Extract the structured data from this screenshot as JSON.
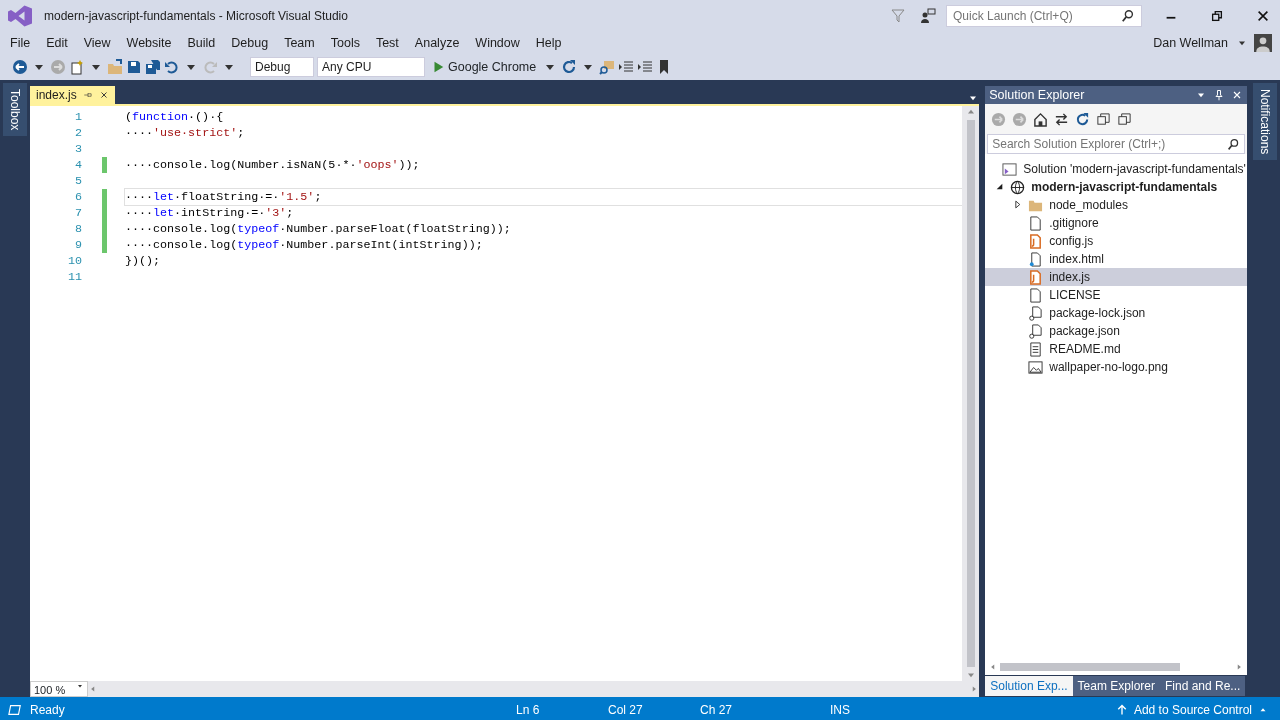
{
  "window": {
    "title": "modern-javascript-fundamentals - Microsoft Visual Studio",
    "quick_launch": {
      "placeholder": "Quick Launch (Ctrl+Q)"
    },
    "user": "Dan Wellman"
  },
  "menu": [
    "File",
    "Edit",
    "View",
    "Website",
    "Build",
    "Debug",
    "Team",
    "Tools",
    "Test",
    "Analyze",
    "Window",
    "Help"
  ],
  "toolbar": {
    "configuration": "Debug",
    "platform": "Any CPU",
    "run_target": "Google Chrome"
  },
  "side_tabs": {
    "left": "Toolbox",
    "right": "Notifications"
  },
  "editor": {
    "tabs": [
      {
        "label": "index.js",
        "selected": true
      }
    ],
    "lines": [
      {
        "number": "1",
        "changed": false,
        "current": false,
        "tokens": [
          {
            "kind": "text",
            "text": "("
          },
          {
            "kind": "keyword",
            "text": "function"
          },
          {
            "kind": "text",
            "text": "·()·{"
          }
        ]
      },
      {
        "number": "2",
        "changed": false,
        "current": false,
        "tokens": [
          {
            "kind": "text",
            "text": "····"
          },
          {
            "kind": "string",
            "text": "'use·strict'"
          },
          {
            "kind": "text",
            "text": ";"
          }
        ]
      },
      {
        "number": "3",
        "changed": false,
        "current": false
      },
      {
        "number": "4",
        "changed": true,
        "current": false,
        "tokens": [
          {
            "kind": "text",
            "text": "····console.log(Number.isNaN(5·*·"
          },
          {
            "kind": "string",
            "text": "'oops'"
          },
          {
            "kind": "text",
            "text": "));"
          }
        ]
      },
      {
        "number": "5",
        "changed": false,
        "current": false
      },
      {
        "number": "6",
        "changed": true,
        "current": true,
        "tokens": [
          {
            "kind": "text",
            "text": "····"
          },
          {
            "kind": "keyword",
            "text": "let"
          },
          {
            "kind": "text",
            "text": "·floatString·=·"
          },
          {
            "kind": "string",
            "text": "'1.5'"
          },
          {
            "kind": "text",
            "text": ";"
          }
        ]
      },
      {
        "number": "7",
        "changed": true,
        "current": false,
        "tokens": [
          {
            "kind": "text",
            "text": "····"
          },
          {
            "kind": "keyword",
            "text": "let"
          },
          {
            "kind": "text",
            "text": "·intString·=·"
          },
          {
            "kind": "string",
            "text": "'3'"
          },
          {
            "kind": "text",
            "text": ";"
          }
        ]
      },
      {
        "number": "8",
        "changed": true,
        "current": false,
        "tokens": [
          {
            "kind": "text",
            "text": "····console.log("
          },
          {
            "kind": "keyword",
            "text": "typeof"
          },
          {
            "kind": "text",
            "text": "·Number.parseFloat(floatString));"
          }
        ]
      },
      {
        "number": "9",
        "changed": true,
        "current": false,
        "tokens": [
          {
            "kind": "text",
            "text": "····console.log("
          },
          {
            "kind": "keyword",
            "text": "typeof"
          },
          {
            "kind": "text",
            "text": "·Number.parseInt(intString));"
          }
        ]
      },
      {
        "number": "10",
        "changed": false,
        "current": false,
        "tokens": [
          {
            "kind": "text",
            "text": "})();"
          }
        ]
      },
      {
        "number": "11",
        "changed": false,
        "current": false
      }
    ],
    "zoom": "100 %"
  },
  "solution_explorer": {
    "title": "Solution Explorer",
    "search": {
      "placeholder": "Search Solution Explorer (Ctrl+;)"
    },
    "tree": [
      {
        "label": "Solution 'modern-javascript-fundamentals'",
        "kind": "solution",
        "selected": false,
        "children": [
          {
            "label": "modern-javascript-fundamentals",
            "kind": "project",
            "expanded": true,
            "selected": false,
            "children": [
              {
                "label": "node_modules",
                "kind": "folder",
                "expanded": false,
                "selected": false
              },
              {
                "label": ".gitignore",
                "kind": "file",
                "selected": false
              },
              {
                "label": "config.js",
                "kind": "js",
                "selected": false
              },
              {
                "label": "index.html",
                "kind": "html",
                "selected": false
              },
              {
                "label": "index.js",
                "kind": "js",
                "selected": true
              },
              {
                "label": "LICENSE",
                "kind": "file",
                "selected": false
              },
              {
                "label": "package-lock.json",
                "kind": "json",
                "selected": false
              },
              {
                "label": "package.json",
                "kind": "json",
                "selected": false
              },
              {
                "label": "README.md",
                "kind": "markdown",
                "selected": false
              },
              {
                "label": "wallpaper-no-logo.png",
                "kind": "image",
                "selected": false
              }
            ]
          }
        ]
      }
    ],
    "tabs": [
      {
        "label": "Solution Exp...",
        "selected": true
      },
      {
        "label": "Team Explorer",
        "selected": false
      },
      {
        "label": "Find and Re...",
        "selected": false
      }
    ]
  },
  "status_bar": {
    "message": "Ready",
    "line": "Ln 6",
    "column": "Col 27",
    "char": "Ch 27",
    "mode": "INS",
    "source_control": "Add to Source Control"
  }
}
